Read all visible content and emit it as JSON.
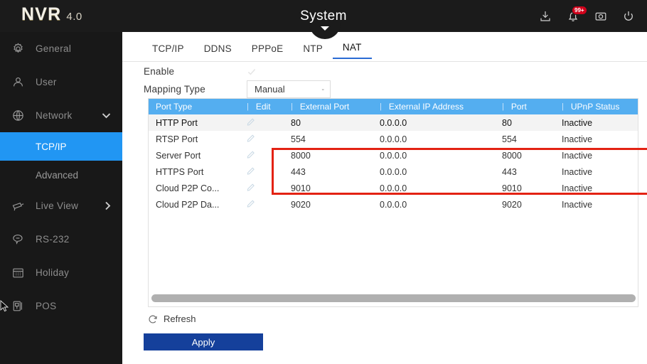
{
  "header": {
    "logo_main": "NVR",
    "logo_version": "4.0",
    "title": "System",
    "icons": [
      {
        "name": "download-icon",
        "label": "Download"
      },
      {
        "name": "bell-icon",
        "label": "Alarm",
        "badge": "99+"
      },
      {
        "name": "display-icon",
        "label": "Display"
      },
      {
        "name": "power-icon",
        "label": "Power"
      }
    ]
  },
  "sidebar": {
    "items": [
      {
        "label": "General",
        "icon": "gear-icon",
        "key": "general",
        "type": "item",
        "arrow": ""
      },
      {
        "label": "User",
        "icon": "user-icon",
        "key": "user",
        "type": "item",
        "arrow": ""
      },
      {
        "label": "Network",
        "icon": "globe-icon",
        "key": "network",
        "type": "item",
        "arrow": "chevron-down-icon"
      },
      {
        "label": "TCP/IP",
        "icon": "",
        "key": "tcpip",
        "type": "sub",
        "active": true
      },
      {
        "label": "Advanced",
        "icon": "",
        "key": "advanced",
        "type": "sub",
        "active": false
      },
      {
        "label": "Live View",
        "icon": "camera-icon",
        "key": "liveview",
        "type": "item",
        "arrow": "chevron-right-icon"
      },
      {
        "label": "RS-232",
        "icon": "chat-icon",
        "key": "rs232",
        "type": "item",
        "arrow": ""
      },
      {
        "label": "Holiday",
        "icon": "calendar-icon",
        "key": "holiday",
        "type": "item",
        "arrow": ""
      },
      {
        "label": "POS",
        "icon": "pos-icon",
        "key": "pos",
        "type": "item",
        "arrow": ""
      }
    ]
  },
  "main": {
    "tabs": [
      {
        "label": "TCP/IP",
        "active": false
      },
      {
        "label": "DDNS",
        "active": false
      },
      {
        "label": "PPPoE",
        "active": false
      },
      {
        "label": "NTP",
        "active": false
      },
      {
        "label": "NAT",
        "active": true
      }
    ],
    "enable": {
      "label": "Enable",
      "checked": true
    },
    "mapping_type": {
      "label": "Mapping Type",
      "value": "Manual",
      "caret": "-"
    },
    "table": {
      "columns": [
        "Port Type",
        "Edit",
        "External Port",
        "External IP Address",
        "Port",
        "UPnP Status"
      ],
      "rows": [
        {
          "port_type": "HTTP Port",
          "edit": "edit-icon",
          "external_port": "80",
          "external_ip": "0.0.0.0",
          "port": "80",
          "status": "Inactive",
          "selected": true,
          "highlighted": true
        },
        {
          "port_type": "RTSP Port",
          "edit": "edit-icon",
          "external_port": "554",
          "external_ip": "0.0.0.0",
          "port": "554",
          "status": "Inactive",
          "selected": false,
          "highlighted": true
        },
        {
          "port_type": "Server Port",
          "edit": "edit-icon",
          "external_port": "8000",
          "external_ip": "0.0.0.0",
          "port": "8000",
          "status": "Inactive",
          "selected": false,
          "highlighted": true
        },
        {
          "port_type": "HTTPS Port",
          "edit": "edit-icon",
          "external_port": "443",
          "external_ip": "0.0.0.0",
          "port": "443",
          "status": "Inactive",
          "selected": false,
          "highlighted": false
        },
        {
          "port_type": "Cloud P2P Co...",
          "edit": "edit-icon",
          "external_port": "9010",
          "external_ip": "0.0.0.0",
          "port": "9010",
          "status": "Inactive",
          "selected": false,
          "highlighted": false
        },
        {
          "port_type": "Cloud P2P Da...",
          "edit": "edit-icon",
          "external_port": "9020",
          "external_ip": "0.0.0.0",
          "port": "9020",
          "status": "Inactive",
          "selected": false,
          "highlighted": false
        }
      ]
    },
    "refresh": {
      "label": "Refresh",
      "icon": "refresh-icon"
    },
    "apply": {
      "label": "Apply"
    }
  },
  "colors": {
    "accent_blue": "#2196f3",
    "table_header_blue": "#54aef0",
    "apply_blue": "#15409b",
    "highlight_red": "#e32213",
    "topbar_dark": "#1b1b1b",
    "sidebar_dark": "#181818",
    "badge_red": "#d0021b"
  }
}
